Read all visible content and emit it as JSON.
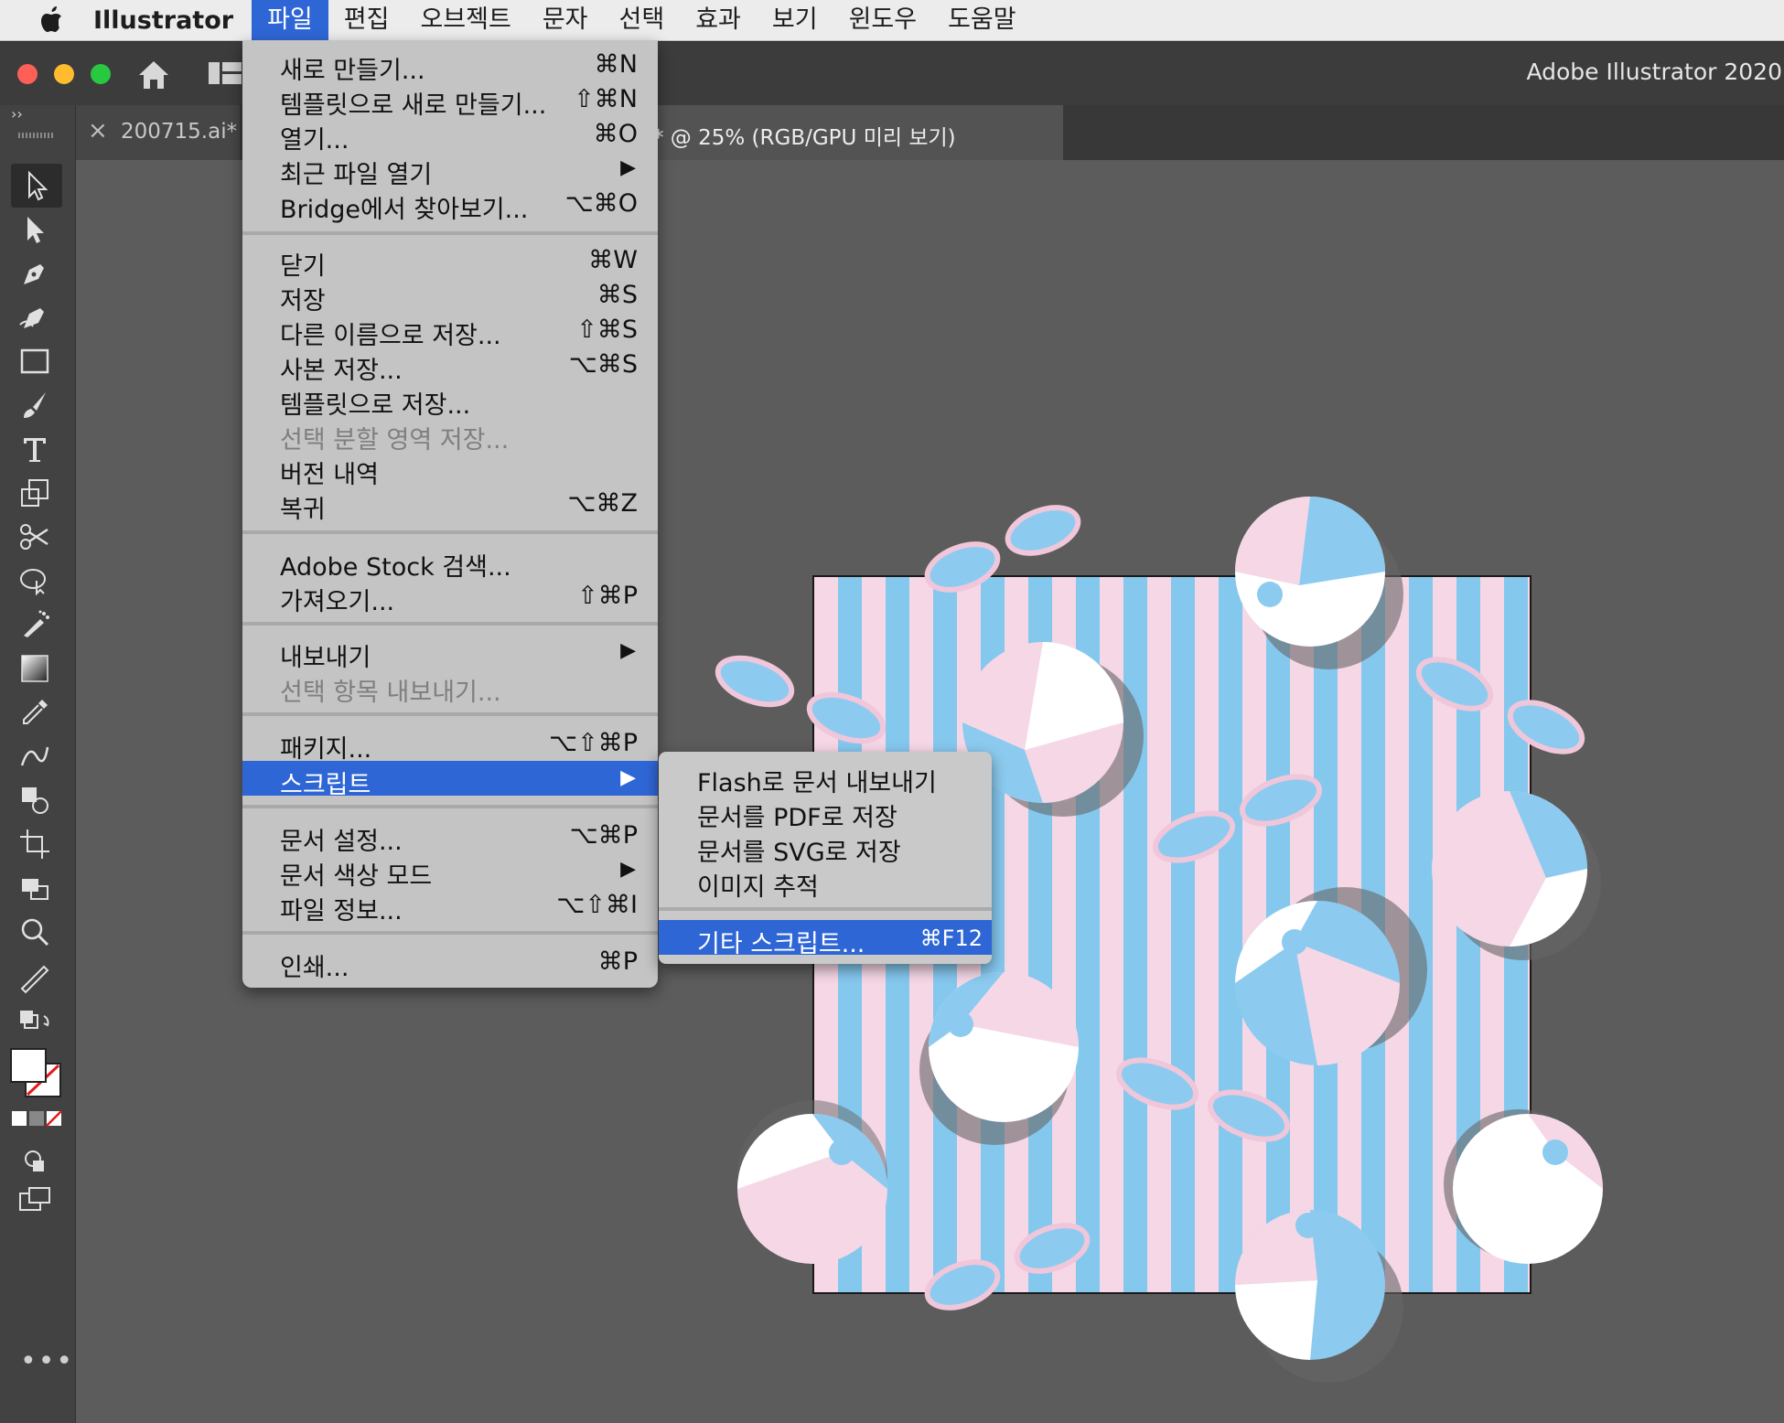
{
  "menubar": {
    "app_name": "Illustrator",
    "items": [
      "파일",
      "편집",
      "오브젝트",
      "문자",
      "선택",
      "효과",
      "보기",
      "윈도우",
      "도움말"
    ],
    "active_index": 0
  },
  "window": {
    "title": "Adobe Illustrator 2020"
  },
  "tabs": [
    {
      "label": "200715.ai*"
    },
    {
      "label": "* @ 25% (RGB/GPU 미리 보기)"
    }
  ],
  "file_menu": {
    "items": [
      {
        "label": "새로 만들기...",
        "shortcut": "⌘N"
      },
      {
        "label": "템플릿으로 새로 만들기...",
        "shortcut": "⇧⌘N"
      },
      {
        "label": "열기...",
        "shortcut": "⌘O"
      },
      {
        "label": "최근 파일 열기",
        "submenu": true
      },
      {
        "label": "Bridge에서 찾아보기...",
        "shortcut": "⌥⌘O"
      },
      {
        "label": "닫기",
        "shortcut": "⌘W"
      },
      {
        "label": "저장",
        "shortcut": "⌘S"
      },
      {
        "label": "다른 이름으로 저장...",
        "shortcut": "⇧⌘S"
      },
      {
        "label": "사본 저장...",
        "shortcut": "⌥⌘S"
      },
      {
        "label": "템플릿으로 저장..."
      },
      {
        "label": "선택 분할 영역 저장...",
        "disabled": true
      },
      {
        "label": "버전 내역"
      },
      {
        "label": "복귀",
        "shortcut": "⌥⌘Z"
      },
      {
        "label": "Adobe Stock 검색..."
      },
      {
        "label": "가져오기...",
        "shortcut": "⇧⌘P"
      },
      {
        "label": "내보내기",
        "submenu": true
      },
      {
        "label": "선택 항목 내보내기...",
        "disabled": true
      },
      {
        "label": "패키지...",
        "shortcut": "⌥⇧⌘P"
      },
      {
        "label": "스크립트",
        "submenu": true,
        "highlighted": true
      },
      {
        "label": "문서 설정...",
        "shortcut": "⌥⌘P"
      },
      {
        "label": "문서 색상 모드",
        "submenu": true
      },
      {
        "label": "파일 정보...",
        "shortcut": "⌥⇧⌘I"
      },
      {
        "label": "인쇄...",
        "shortcut": "⌘P"
      }
    ],
    "submenu_arrow": "▶"
  },
  "script_submenu": {
    "items": [
      {
        "label": "Flash로 문서 내보내기"
      },
      {
        "label": "문서를 PDF로 저장"
      },
      {
        "label": "문서를 SVG로 저장"
      },
      {
        "label": "이미지 추적"
      },
      {
        "label": "기타 스크립트...",
        "shortcut": "⌘F12",
        "highlighted": true
      }
    ]
  },
  "toolbar": {
    "more_label": "•••",
    "tools": [
      "selection-tool-icon",
      "direct-selection-tool-icon",
      "pen-tool-icon",
      "curvature-tool-icon",
      "rectangle-tool-icon",
      "paintbrush-tool-icon",
      "type-tool-icon",
      "scale-tool-icon",
      "scissors-tool-icon",
      "puppet-warp-tool-icon",
      "symbol-sprayer-tool-icon",
      "gradient-tool-icon",
      "eyedropper-tool-icon",
      "blend-tool-icon",
      "shape-builder-tool-icon",
      "artboard-tool-icon",
      "live-paint-tool-icon",
      "zoom-tool-icon",
      "measure-tool-icon"
    ]
  },
  "colors": {
    "accent": "#2f66d6",
    "stripe_pink": "#f6d7e6",
    "stripe_blue": "#85c8ee",
    "canvas_bg": "#5c5c5c"
  }
}
